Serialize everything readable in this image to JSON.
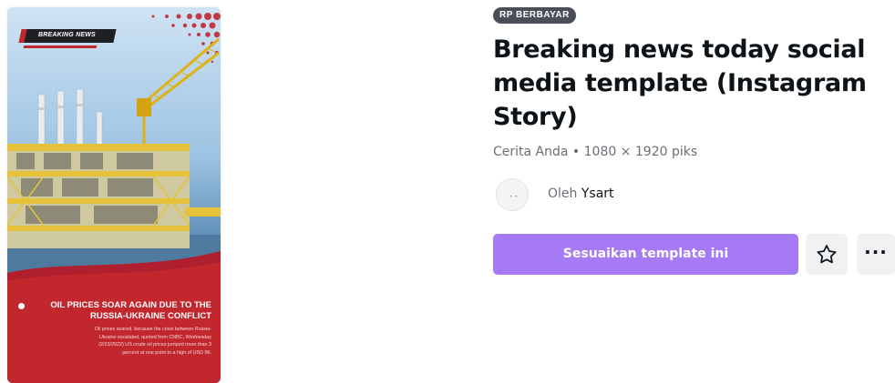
{
  "preview": {
    "banner_label": "BREAKING NEWS",
    "headline": "OIL PRICES SOAR AGAIN DUE TO THE\nRUSSIA-UKRAINE CONFLICT",
    "body": "Oil prices soared. because the crisis between Russia-\nUkraine escalated. quoted from CNBC, Wednesday\n(2/23/2022) US crude oil prices jumped more than 3\npercent at one point to a high of USD 96."
  },
  "info": {
    "badge": "RP BERBAYAR",
    "title": "Breaking news today social\nmedia template (Instagram\nStory)",
    "meta": "Cerita Anda • 1080 × 1920 piks",
    "author_prefix": "Oleh",
    "author_name": "Ysart",
    "cta_label": "Sesuaikan template ini"
  },
  "colors": {
    "accent": "#a67af5",
    "badge_bg": "#4a4f57",
    "news_red": "#c1272d"
  },
  "icons": {
    "favorite": "star-outline-icon",
    "more": "more-horizontal-icon"
  }
}
